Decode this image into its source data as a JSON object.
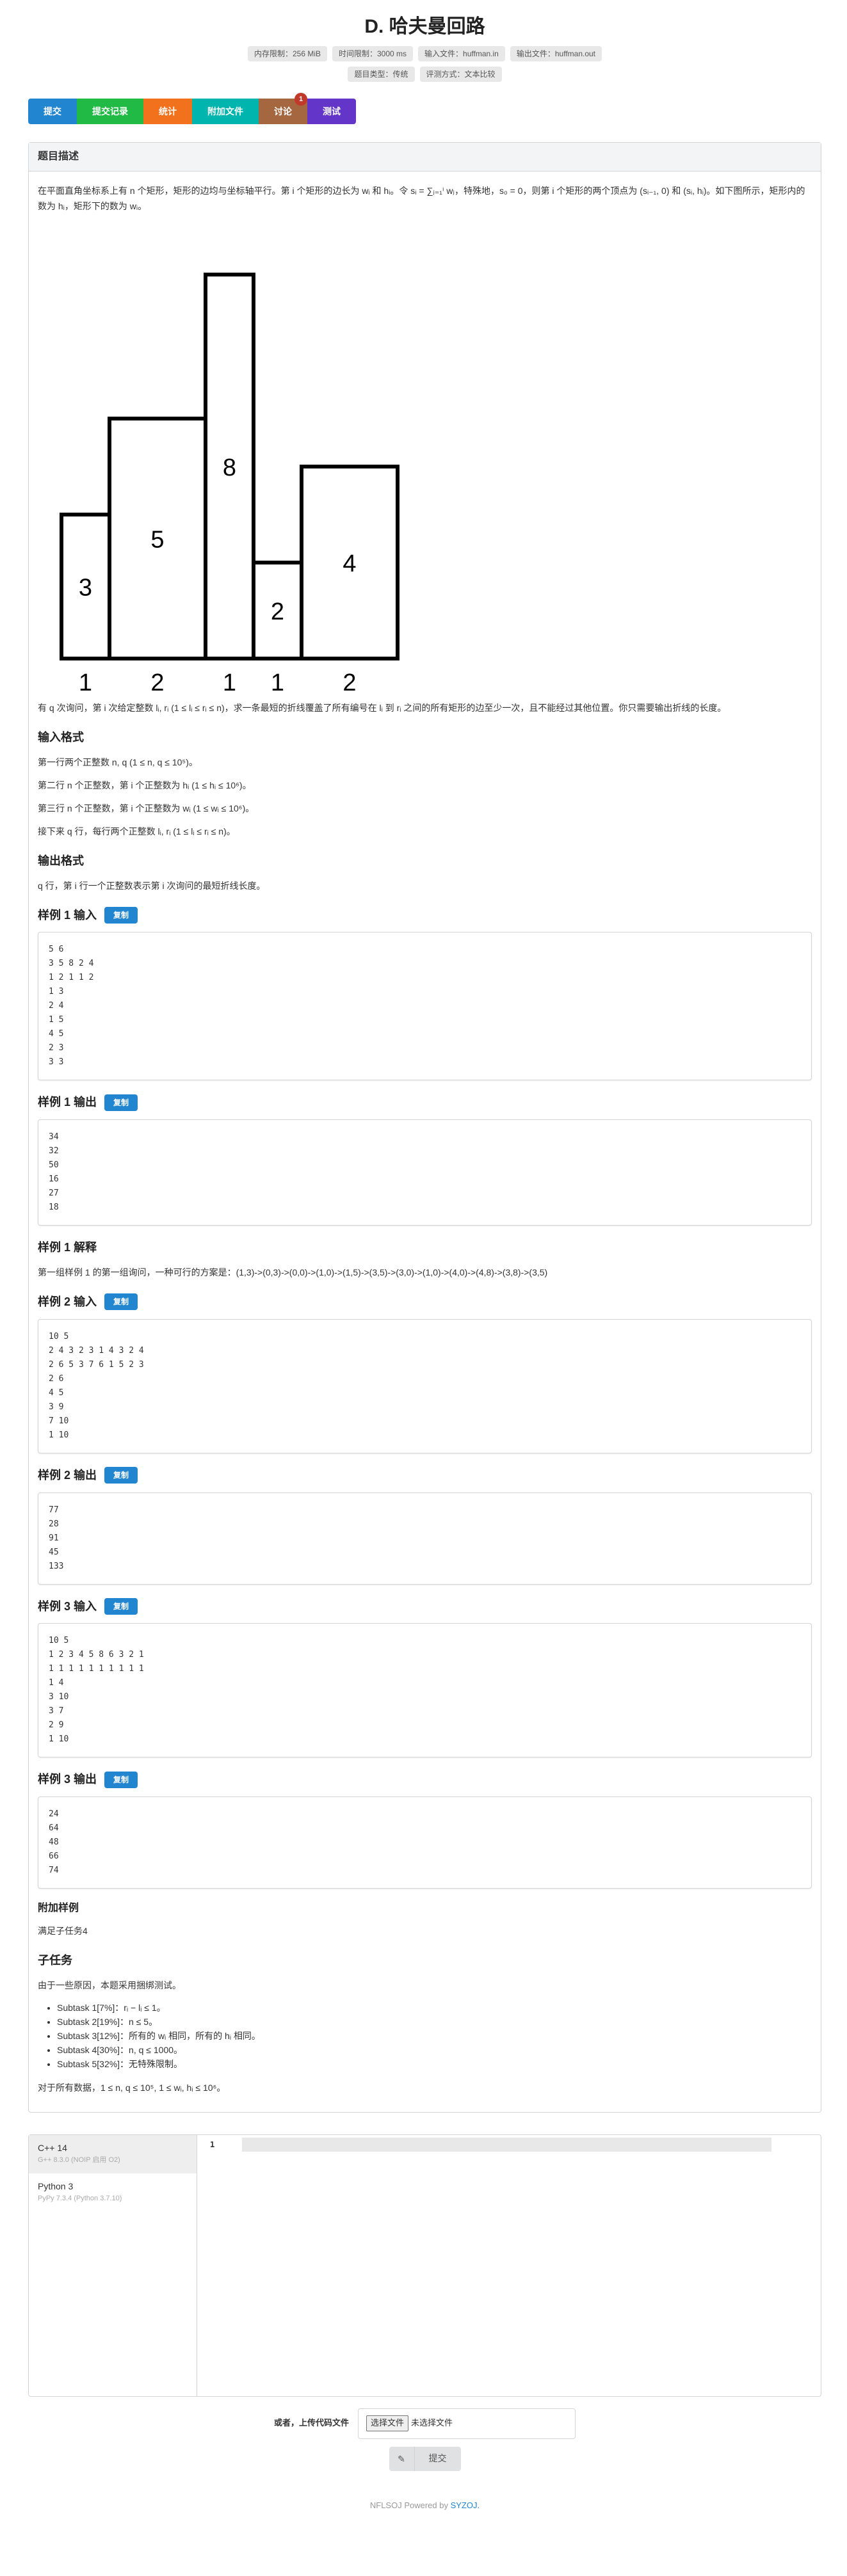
{
  "problem": {
    "title": "D. 哈夫曼回路",
    "labels_row1": [
      "内存限制：256 MiB",
      "时间限制：3000 ms",
      "输入文件：huffman.in",
      "输出文件：huffman.out"
    ],
    "labels_row2": [
      "题目类型：传统",
      "评测方式：文本比较"
    ]
  },
  "buttons": [
    {
      "label": "提交",
      "color": "#2185d0"
    },
    {
      "label": "提交记录",
      "color": "#21ba45"
    },
    {
      "label": "统计",
      "color": "#f2711c"
    },
    {
      "label": "附加文件",
      "color": "#00b5ad"
    },
    {
      "label": "讨论",
      "color": "#a5673f",
      "badge": "1"
    },
    {
      "label": "测试",
      "color": "#6435c9"
    }
  ],
  "section_title": "题目描述",
  "figure": {
    "bar_labels": [
      "3",
      "5",
      "8",
      "2",
      "4"
    ],
    "width_labels": [
      "1",
      "2",
      "1",
      "1",
      "2"
    ],
    "heights": [
      3,
      5,
      8,
      2,
      4
    ],
    "widths": [
      1,
      2,
      1,
      1,
      2
    ]
  },
  "text": {
    "intro": "在平面直角坐标系上有 n 个矩形，矩形的边均与坐标轴平行。第 i 个矩形的边长为 wᵢ 和 hᵢ。令 sᵢ = ∑ⱼ₌₁ⁱ wⱼ，特殊地，s₀ = 0，则第 i 个矩形的两个顶点为 (sᵢ₋₁, 0) 和 (sᵢ, hᵢ)。如下图所示，矩形内的数为 hᵢ，矩形下的数为 wᵢ。",
    "query": "有 q 次询问，第 i 次给定整数 lᵢ, rᵢ (1 ≤ lᵢ ≤ rᵢ ≤ n)，求一条最短的折线覆盖了所有编号在 lᵢ 到 rᵢ 之间的所有矩形的边至少一次，且不能经过其他位置。你只需要输出折线的长度。",
    "input_title": "输入格式",
    "input_lines": [
      "第一行两个正整数 n, q (1 ≤ n, q ≤ 10⁵)。",
      "第二行 n 个正整数，第 i 个正整数为 hᵢ (1 ≤ hᵢ ≤ 10⁶)。",
      "第三行 n 个正整数，第 i 个正整数为 wᵢ (1 ≤ wᵢ ≤ 10⁶)。",
      "接下来 q 行，每行两个正整数 lᵢ, rᵢ (1 ≤ lᵢ ≤ rᵢ ≤ n)。"
    ],
    "output_title": "输出格式",
    "output_line": "q 行，第 i 行一个正整数表示第 i 次询问的最短折线长度。",
    "explain_title": "样例 1 解释",
    "explain_line": "第一组样例 1 的第一组询问，一种可行的方案是：(1,3)->(0,3)->(0,0)->(1,0)->(1,5)->(3,5)->(3,0)->(1,0)->(4,0)->(4,8)->(3,8)->(3,5)",
    "extra_title": "附加样例",
    "extra_line": "满足子任务4",
    "subtask_title": "子任务",
    "subtask_intro": "由于一些原因，本题采用捆绑测试。",
    "subtasks": [
      "Subtask 1[7%]：rᵢ − lᵢ ≤ 1。",
      "Subtask 2[19%]：n ≤ 5。",
      "Subtask 3[12%]：所有的 wᵢ 相同，所有的 hᵢ 相同。",
      "Subtask 4[30%]：n, q ≤ 1000。",
      "Subtask 5[32%]：无特殊限制。"
    ],
    "all_data": "对于所有数据，1 ≤ n, q ≤ 10⁵, 1 ≤ wᵢ, hᵢ ≤ 10⁶。"
  },
  "copy_label": "复制",
  "samples": [
    {
      "title": "样例 1 输入",
      "content": "5 6\n3 5 8 2 4\n1 2 1 1 2\n1 3\n2 4\n1 5\n4 5\n2 3\n3 3"
    },
    {
      "title": "样例 1 输出",
      "content": "34\n32\n50\n16\n27\n18"
    },
    {
      "title": "样例 2 输入",
      "content": "10 5\n2 4 3 2 3 1 4 3 2 4\n2 6 5 3 7 6 1 5 2 3\n2 6\n4 5\n3 9\n7 10\n1 10"
    },
    {
      "title": "样例 2 输出",
      "content": "77\n28\n91\n45\n133"
    },
    {
      "title": "样例 3 输入",
      "content": "10 5\n1 2 3 4 5 8 6 3 2 1\n1 1 1 1 1 1 1 1 1 1\n1 4\n3 10\n3 7\n2 9\n1 10"
    },
    {
      "title": "样例 3 输出",
      "content": "24\n64\n48\n66\n74"
    }
  ],
  "editor": {
    "languages": [
      {
        "name": "C++ 14",
        "version": "G++ 8.3.0 (NOIP 启用 O2)"
      },
      {
        "name": "Python 3",
        "version": "PyPy 7.3.4 (Python 3.7.10)"
      }
    ],
    "line_number": "1"
  },
  "upload": {
    "label": "或者，上传代码文件",
    "file_button": "选择文件",
    "file_none": "未选择文件",
    "submit_label": "提交"
  },
  "footer": {
    "prefix": "NFLSOJ Powered by ",
    "link": "SYZOJ."
  }
}
